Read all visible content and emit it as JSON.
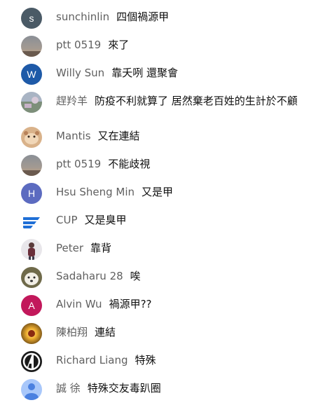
{
  "messages": [
    {
      "author": "sunchinlin",
      "message": "四個禍源甲",
      "avatar": {
        "type": "letter",
        "letter": "s",
        "color": "#4a5a66"
      }
    },
    {
      "author": "ptt 0519",
      "message": "來了",
      "avatar": {
        "type": "photo",
        "icon": "sunset-photo"
      }
    },
    {
      "author": "Willy Sun",
      "message": "靠夭咧 還聚會",
      "avatar": {
        "type": "letter",
        "letter": "W",
        "color": "#1e5aa8"
      }
    },
    {
      "author": "趕羚羊",
      "message": "防疫不利就算了 居然棄老百姓的生計於不顧",
      "avatar": {
        "type": "photo",
        "icon": "landscape-photo"
      }
    },
    {
      "author": "Mantis",
      "message": "又在連結",
      "avatar": {
        "type": "photo",
        "icon": "hamster-photo"
      }
    },
    {
      "author": "ptt 0519",
      "message": "不能歧視",
      "avatar": {
        "type": "photo",
        "icon": "sunset-photo"
      }
    },
    {
      "author": "Hsu Sheng Min",
      "message": "又是甲",
      "avatar": {
        "type": "letter",
        "letter": "H",
        "color": "#5c6bc0"
      }
    },
    {
      "author": "CUP",
      "message": "又是臭甲",
      "avatar": {
        "type": "photo",
        "icon": "cup-logo"
      }
    },
    {
      "author": "Peter",
      "message": "靠背",
      "avatar": {
        "type": "photo",
        "icon": "person-photo"
      }
    },
    {
      "author": "Sadaharu 28",
      "message": "唉",
      "avatar": {
        "type": "photo",
        "icon": "dog-photo"
      }
    },
    {
      "author": "Alvin Wu",
      "message": "禍源甲??",
      "avatar": {
        "type": "letter",
        "letter": "A",
        "color": "#c2185b"
      }
    },
    {
      "author": "陳柏翔",
      "message": "連結",
      "avatar": {
        "type": "photo",
        "icon": "sunburst-photo"
      }
    },
    {
      "author": "Richard Liang",
      "message": "特殊",
      "avatar": {
        "type": "photo",
        "icon": "avengers-logo"
      }
    },
    {
      "author": "誠 徐",
      "message": "特殊交友毒趴圈",
      "avatar": {
        "type": "photo",
        "icon": "default-user-icon"
      }
    }
  ]
}
